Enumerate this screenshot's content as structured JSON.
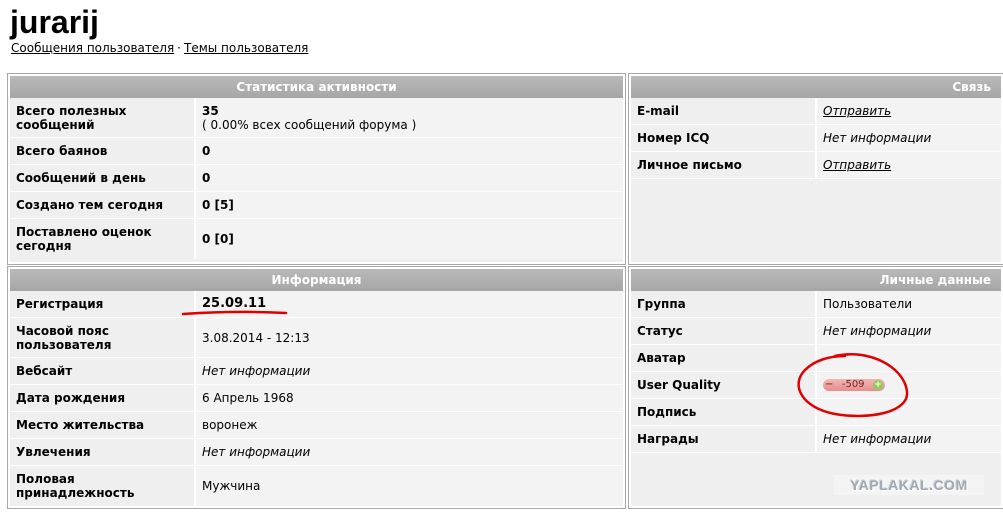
{
  "profile": {
    "username": "jurarij",
    "links": {
      "posts": "Сообщения пользователя",
      "separator": "·",
      "topics": "Темы пользователя"
    }
  },
  "stats": {
    "title": "Статистика активности",
    "rows": [
      {
        "label": "Всего полезных сообщений",
        "value": "35",
        "extra": "( 0.00% всех сообщений форума )"
      },
      {
        "label": "Всего баянов",
        "value": "0"
      },
      {
        "label": "Сообщений в день",
        "value": "0"
      },
      {
        "label": "Создано тем сегодня",
        "value": "0 [5]"
      },
      {
        "label": "Поставлено оценок сегодня",
        "value": "0 [0]"
      }
    ]
  },
  "contact": {
    "title": "Связь",
    "rows": [
      {
        "label": "E-mail",
        "value": "Отправить"
      },
      {
        "label": "Номер ICQ",
        "value": "Нет информации"
      },
      {
        "label": "Личное письмо",
        "value": "Отправить"
      }
    ]
  },
  "info": {
    "title": "Информация",
    "rows": [
      {
        "label": "Регистрация",
        "value": "25.09.11"
      },
      {
        "label": "Часовой пояс пользователя",
        "value": "3.08.2014 - 12:13"
      },
      {
        "label": "Вебсайт",
        "value": "Нет информации"
      },
      {
        "label": "Дата рождения",
        "value": "6 Апрель 1968"
      },
      {
        "label": "Место жительства",
        "value": "воронеж"
      },
      {
        "label": "Увлечения",
        "value": "Нет информации"
      },
      {
        "label": "Половая принадлежность",
        "value": "Мужчина"
      }
    ]
  },
  "personal": {
    "title": "Личные данные",
    "rows": [
      {
        "label": "Группа",
        "value": "Пользователи"
      },
      {
        "label": "Статус",
        "value": "Нет информации"
      },
      {
        "label": "Аватар",
        "value": ""
      },
      {
        "label": "User Quality",
        "value": "-509",
        "minus": "−",
        "plus": "+"
      },
      {
        "label": "Подпись",
        "value": ""
      },
      {
        "label": "Награды",
        "value": "Нет информации"
      }
    ]
  },
  "watermark": "YAPLAKAL.COM",
  "colors": {
    "annotation_red": "#e00000",
    "header_gray": "#aaaaaa",
    "panel_bg": "#efefef"
  }
}
